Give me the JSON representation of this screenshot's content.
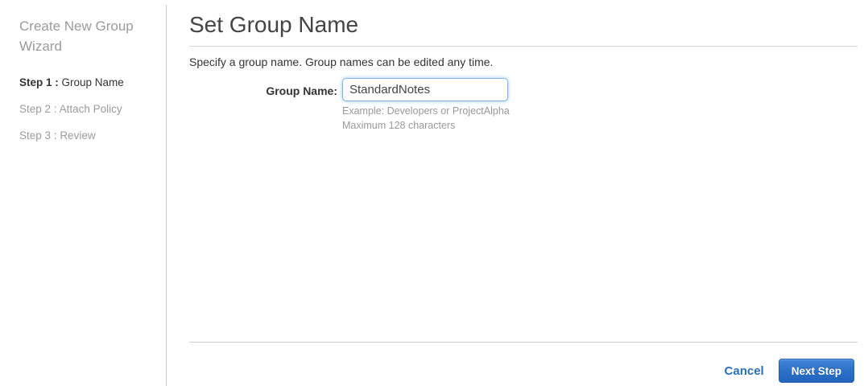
{
  "sidebar": {
    "title": "Create New Group Wizard",
    "steps": [
      {
        "prefix": "Step 1 :",
        "label": "Group Name"
      },
      {
        "prefix": "Step 2 :",
        "label": "Attach Policy"
      },
      {
        "prefix": "Step 3 :",
        "label": "Review"
      }
    ]
  },
  "main": {
    "title": "Set Group Name",
    "description": "Specify a group name. Group names can be edited any time.",
    "form": {
      "group_name_label": "Group Name:",
      "group_name_value": "StandardNotes",
      "hint_example": "Example: Developers or ProjectAlpha",
      "hint_max": "Maximum 128 characters"
    },
    "footer": {
      "cancel_label": "Cancel",
      "next_label": "Next Step"
    }
  },
  "colors": {
    "link_blue": "#2a6db8",
    "button_blue_top": "#4186d8",
    "button_blue_bottom": "#2264bc",
    "focus_border": "#85b3e4",
    "muted_text": "#9b9b9b"
  }
}
